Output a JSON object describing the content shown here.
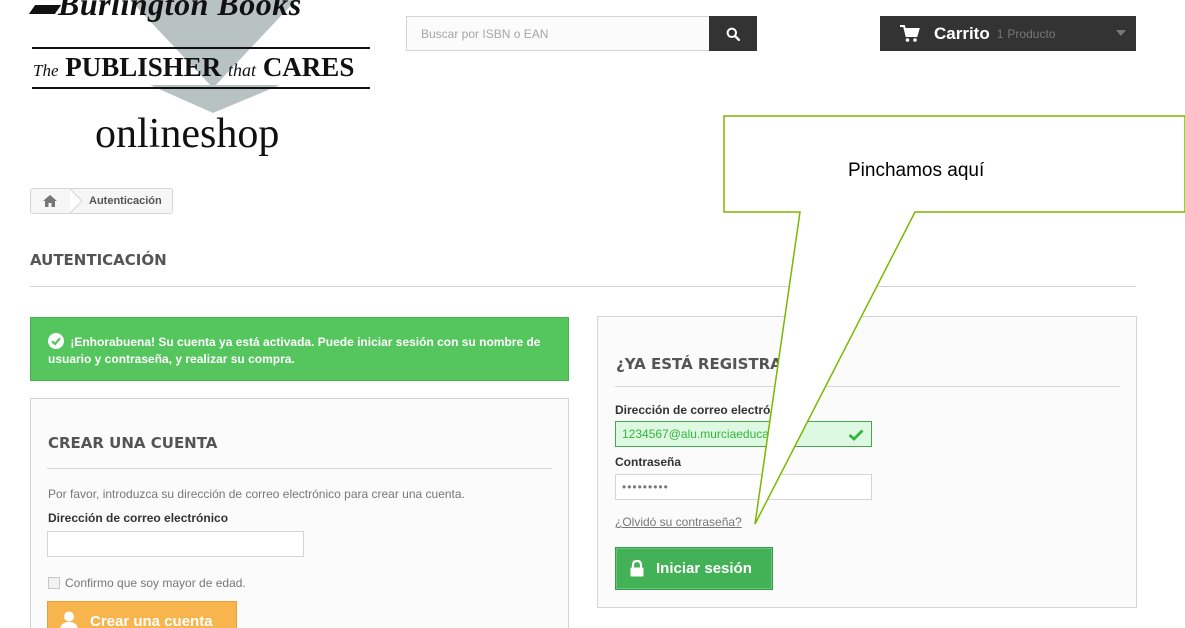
{
  "logo": {
    "brand_name": "Burlington Books",
    "tagline_the": "The",
    "tagline_publisher": "PUBLISHER",
    "tagline_that": "that",
    "tagline_cares": "CARES",
    "shop_name": "onlineshop"
  },
  "search": {
    "placeholder": "Buscar por ISBN o EAN",
    "icon": "search-icon"
  },
  "cart": {
    "label": "Carrito",
    "count": "1",
    "unit": "Producto",
    "icon": "cart-icon"
  },
  "breadcrumb": {
    "home_icon": "home-icon",
    "current": "Autenticación"
  },
  "page": {
    "title": "AUTENTICACIÓN"
  },
  "alert": {
    "message": "¡Enhorabuena! Su cuenta ya está activada. Puede iniciar sesión con su nombre de usuario y contraseña, y realizar su compra."
  },
  "create_account": {
    "heading": "CREAR UNA CUENTA",
    "description": "Por favor, introduzca su dirección de correo electrónico para crear una cuenta.",
    "email_label": "Dirección de correo electrónico",
    "email_value": "",
    "confirm_label": "Confirmo que soy mayor de edad.",
    "button_label": "Crear una cuenta"
  },
  "login": {
    "heading": "¿YA ESTÁ REGISTRADO?",
    "email_label": "Dirección de correo electrónico",
    "email_value": "1234567@alu.murciaeduca.es",
    "password_label": "Contraseña",
    "password_value": "•••••••••",
    "forgot_link": "¿Olvidó su contraseña?",
    "button_label": "Iniciar sesión"
  },
  "annotation": {
    "callout_text": "Pinchamos aquí"
  },
  "colors": {
    "success_green": "#55c65e",
    "button_green": "#43b155",
    "button_orange": "#f8b54d",
    "dark": "#333333"
  }
}
